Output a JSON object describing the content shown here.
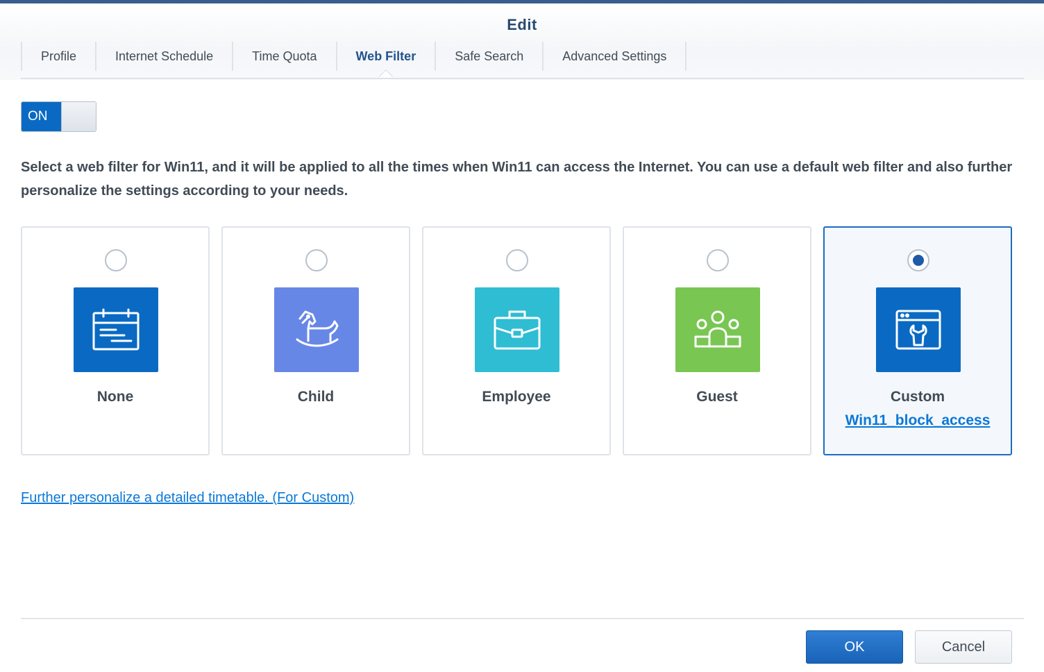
{
  "dialog": {
    "title": "Edit"
  },
  "tabs": [
    {
      "label": "Profile",
      "active": false
    },
    {
      "label": "Internet Schedule",
      "active": false
    },
    {
      "label": "Time Quota",
      "active": false
    },
    {
      "label": "Web Filter",
      "active": true
    },
    {
      "label": "Safe Search",
      "active": false
    },
    {
      "label": "Advanced Settings",
      "active": false
    }
  ],
  "toggle": {
    "label": "ON",
    "state": true
  },
  "description": "Select a web filter for Win11, and it will be applied to all the times when Win11 can access the Internet. You can use a default web filter and also further personalize the settings according to your needs.",
  "filters": [
    {
      "label": "None",
      "icon": "calendar-icon",
      "color": "#0a6ac3",
      "selected": false
    },
    {
      "label": "Child",
      "icon": "rocking-horse-icon",
      "color": "#6787e7",
      "selected": false
    },
    {
      "label": "Employee",
      "icon": "briefcase-icon",
      "color": "#2fbdd3",
      "selected": false
    },
    {
      "label": "Guest",
      "icon": "group-icon",
      "color": "#79c653",
      "selected": false
    },
    {
      "label": "Custom",
      "icon": "browser-wrench-icon",
      "color": "#0a6ac3",
      "selected": true,
      "link": "Win11_block_access"
    }
  ],
  "personalize_link": "Further personalize a detailed timetable. (For Custom)",
  "buttons": {
    "ok": "OK",
    "cancel": "Cancel"
  }
}
